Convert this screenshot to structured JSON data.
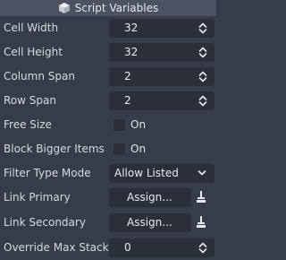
{
  "header": {
    "title": "Script Variables",
    "icon": "script-cube-icon"
  },
  "properties": [
    {
      "label": "Cell Width",
      "type": "spin",
      "value": "32"
    },
    {
      "label": "Cell Height",
      "type": "spin",
      "value": "32"
    },
    {
      "label": "Column Span",
      "type": "spin",
      "value": "2"
    },
    {
      "label": "Row Span",
      "type": "spin",
      "value": "2"
    },
    {
      "label": "Free Size",
      "type": "checkbox",
      "checkbox_label": "On",
      "checked": false
    },
    {
      "label": "Block Bigger Items",
      "type": "checkbox",
      "checkbox_label": "On",
      "checked": false
    },
    {
      "label": "Filter Type Mode",
      "type": "select",
      "value": "Allow Listed"
    },
    {
      "label": "Link Primary",
      "type": "resource",
      "value": "Assign..."
    },
    {
      "label": "Link Secondary",
      "type": "resource",
      "value": "Assign..."
    },
    {
      "label": "Override Max Stack",
      "type": "spin",
      "value": "0"
    }
  ],
  "colors": {
    "background": "#363d4a",
    "header": "#4b5261",
    "field": "#2a2f38",
    "text": "#d9dce2"
  }
}
